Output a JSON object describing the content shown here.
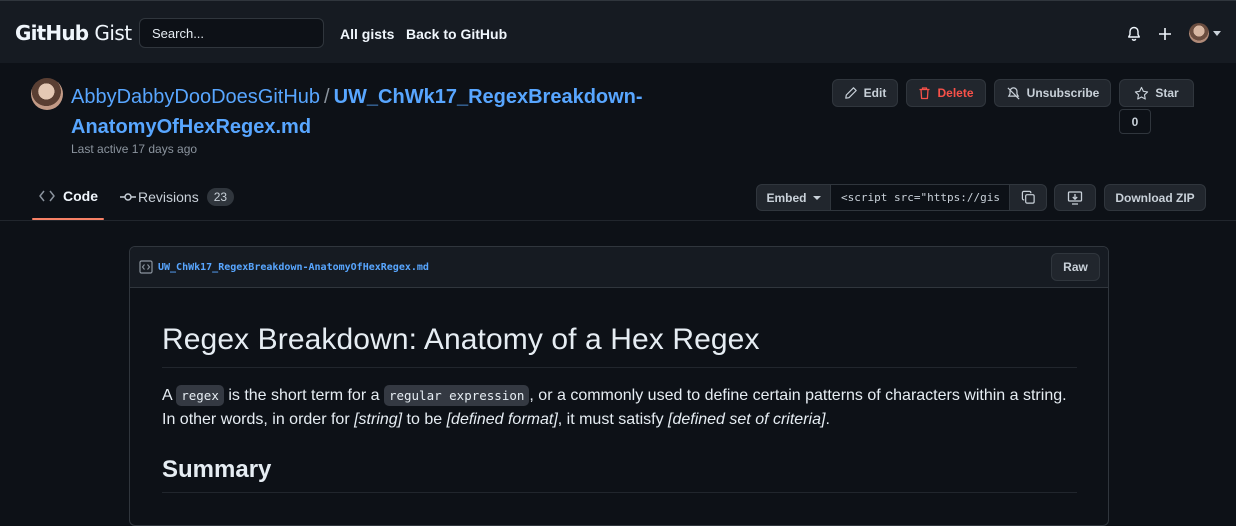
{
  "header": {
    "logo_github": "GitHub",
    "logo_gist": "Gist",
    "search_placeholder": "Search...",
    "all_gists": "All gists",
    "back_to_github": "Back to GitHub"
  },
  "gist": {
    "owner": "AbbyDabbyDooDoesGitHub",
    "separator": "/",
    "filename_title": "UW_ChWk17_RegexBreakdown-AnatomyOfHexRegex.md",
    "last_active": "Last active 17 days ago",
    "actions": {
      "edit": "Edit",
      "delete": "Delete",
      "unsubscribe": "Unsubscribe",
      "star": "Star",
      "star_count": "0"
    }
  },
  "tabs": [
    {
      "label": "Code"
    },
    {
      "label": "Revisions",
      "count": "23"
    }
  ],
  "embed": {
    "label": "Embed",
    "value": "<script src=\"https://gist",
    "download": "Download ZIP"
  },
  "file": {
    "name": "UW_ChWk17_RegexBreakdown-AnatomyOfHexRegex.md",
    "raw": "Raw",
    "heading": "Regex Breakdown: Anatomy of a Hex Regex",
    "p1": {
      "a": "A ",
      "code1": "regex",
      "b": " is the short term for a ",
      "code2": "regular expression",
      "c": ", or a commonly used to define certain patterns of characters within a string. In other words, in order for ",
      "em1": "[string]",
      "d": " to be ",
      "em2": "[defined format]",
      "e": ", it must satisfy ",
      "em3": "[defined set of criteria]",
      "f": "."
    },
    "summary": "Summary"
  },
  "colors": {
    "background": "#0d1117",
    "header_bg": "#161b22",
    "link": "#58a6ff",
    "danger": "#f85149",
    "tab_underline": "#f78166"
  }
}
